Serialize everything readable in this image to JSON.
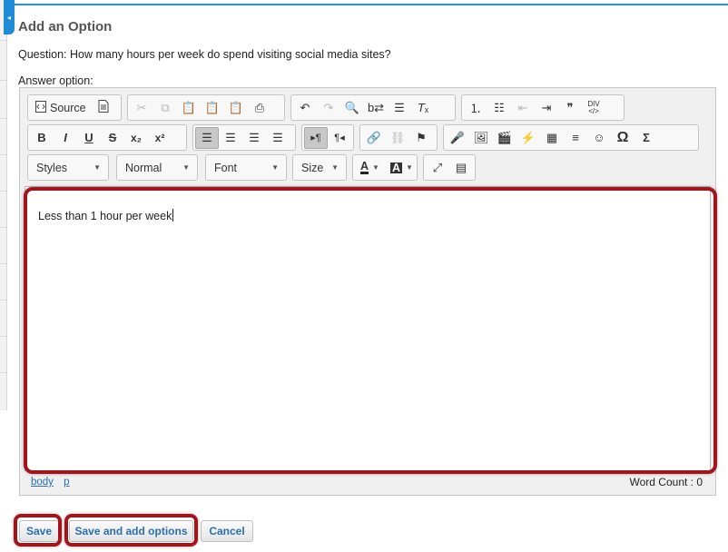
{
  "header": {
    "title": "Add an Option",
    "question": "Question: How many hours per week do spend visiting social media sites?",
    "answer_label": "Answer option:"
  },
  "toolbar": {
    "source_label": "Source",
    "styles_label": "Styles",
    "format_label": "Normal",
    "font_label": "Font",
    "size_label": "Size",
    "text_color_label": "A",
    "bg_color_label": "A",
    "bold": "B",
    "italic": "I",
    "underline": "U",
    "strike": "S",
    "subscript": "x₂",
    "superscript": "x²",
    "omega": "Ω",
    "sigma": "Σ",
    "quote": "❞",
    "ltr": "▸¶",
    "rtl": "¶◂"
  },
  "editor": {
    "content": "Less than 1 hour per week",
    "path": [
      "body",
      "p"
    ],
    "word_count": "Word Count : 0"
  },
  "buttons": {
    "save": "Save",
    "save_add": "Save and add options",
    "cancel": "Cancel"
  },
  "colors": {
    "accent": "#2a93d5",
    "highlight": "#a3141c",
    "link": "#2a6fb0"
  }
}
